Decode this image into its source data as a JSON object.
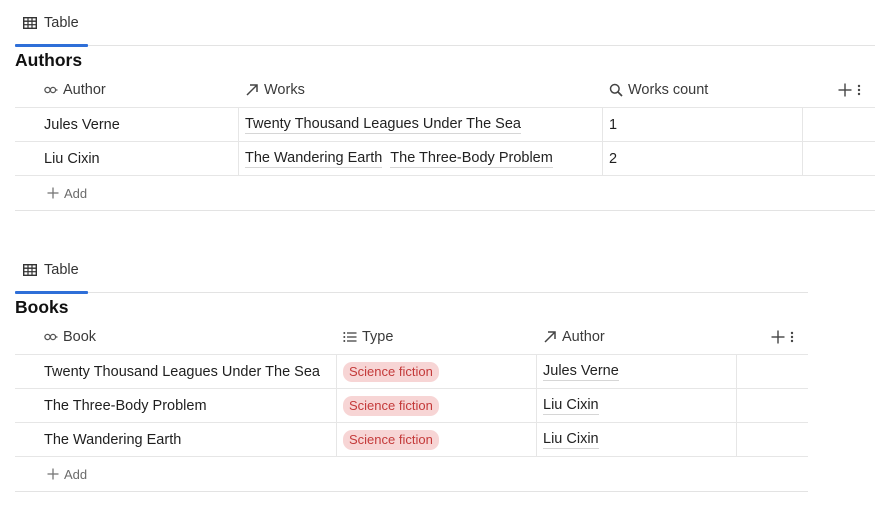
{
  "databases": [
    {
      "view_tab": "Table",
      "title": "Authors",
      "columns": [
        {
          "label": "Author",
          "icon": "key-icon"
        },
        {
          "label": "Works",
          "icon": "relation-arrow-icon"
        },
        {
          "label": "Works count",
          "icon": "search-icon"
        }
      ],
      "rows": [
        {
          "author": "Jules Verne",
          "works": [
            "Twenty Thousand Leagues Under The Sea"
          ],
          "count": "1"
        },
        {
          "author": "Liu Cixin",
          "works": [
            "The Wandering Earth",
            "The Three-Body Problem"
          ],
          "count": "2"
        }
      ],
      "add_label": "Add"
    },
    {
      "view_tab": "Table",
      "title": "Books",
      "columns": [
        {
          "label": "Book",
          "icon": "key-icon"
        },
        {
          "label": "Type",
          "icon": "list-icon"
        },
        {
          "label": "Author",
          "icon": "relation-arrow-icon"
        }
      ],
      "rows": [
        {
          "book": "Twenty Thousand Leagues Under The Sea",
          "type": "Science fiction",
          "author": "Jules Verne"
        },
        {
          "book": "The Three-Body Problem",
          "type": "Science fiction",
          "author": "Liu Cixin"
        },
        {
          "book": "The Wandering Earth",
          "type": "Science fiction",
          "author": "Liu Cixin"
        }
      ],
      "add_label": "Add"
    }
  ],
  "colors": {
    "accent": "#2f6fd8",
    "tag_bg": "#f7d5d5",
    "tag_text": "#c43a3a"
  }
}
